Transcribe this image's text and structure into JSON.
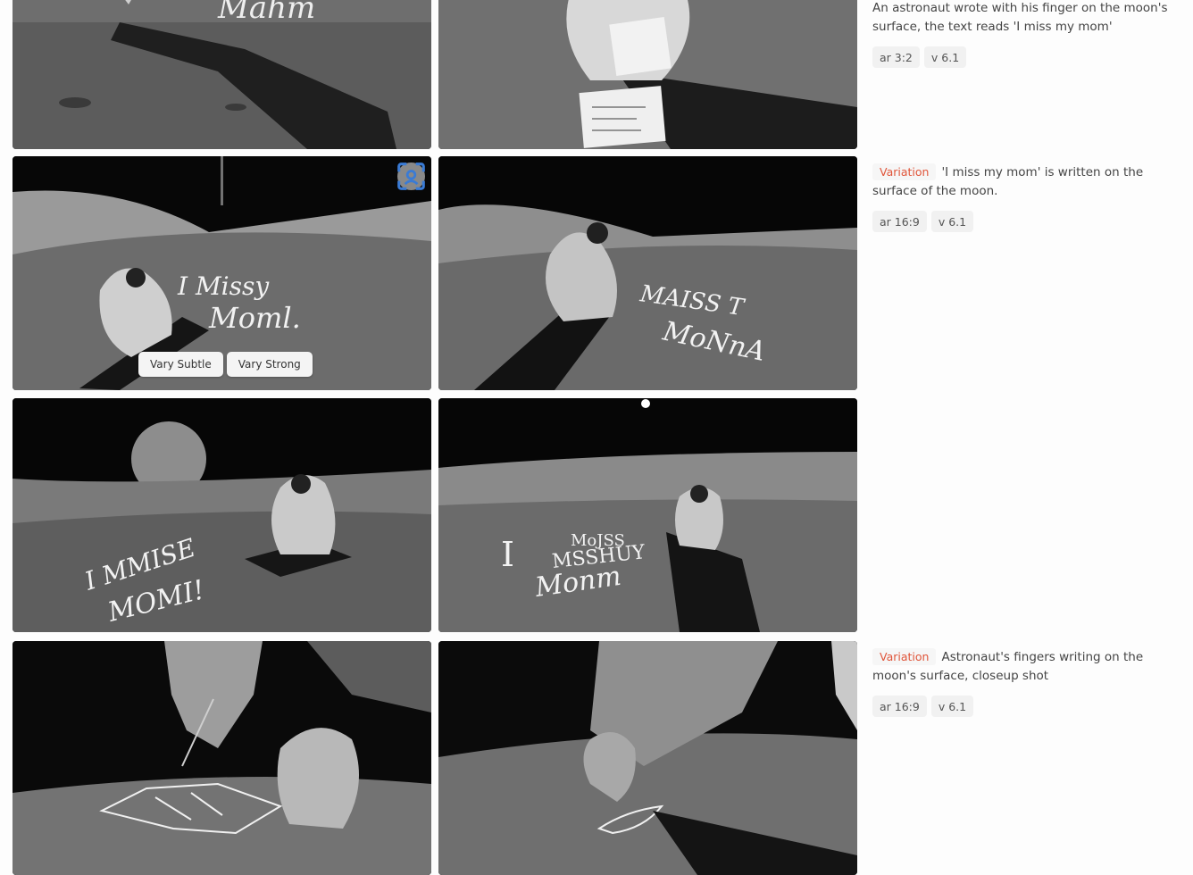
{
  "prompts": [
    {
      "variation_label": "",
      "text": "An astronaut wrote with his finger on the moon's surface, the text reads 'I miss my mom'",
      "tags": [
        "ar 3:2",
        "v 6.1"
      ]
    },
    {
      "variation_label": "Variation",
      "text": "'I miss my mom' is written on the surface of the moon.",
      "tags": [
        "ar 16:9",
        "v 6.1"
      ]
    },
    {
      "variation_label": "Variation",
      "text": "Astronaut's fingers writing on the moon's surface, closeup shot",
      "tags": [
        "ar 16:9",
        "v 6.1"
      ]
    }
  ],
  "vary_buttons": {
    "subtle": "Vary Subtle",
    "strong": "Vary Strong"
  },
  "icons": {
    "zoom": "focus-scan-icon"
  },
  "colors": {
    "variation_accent": "#e0553a",
    "tag_bg": "#f1f1f1"
  }
}
